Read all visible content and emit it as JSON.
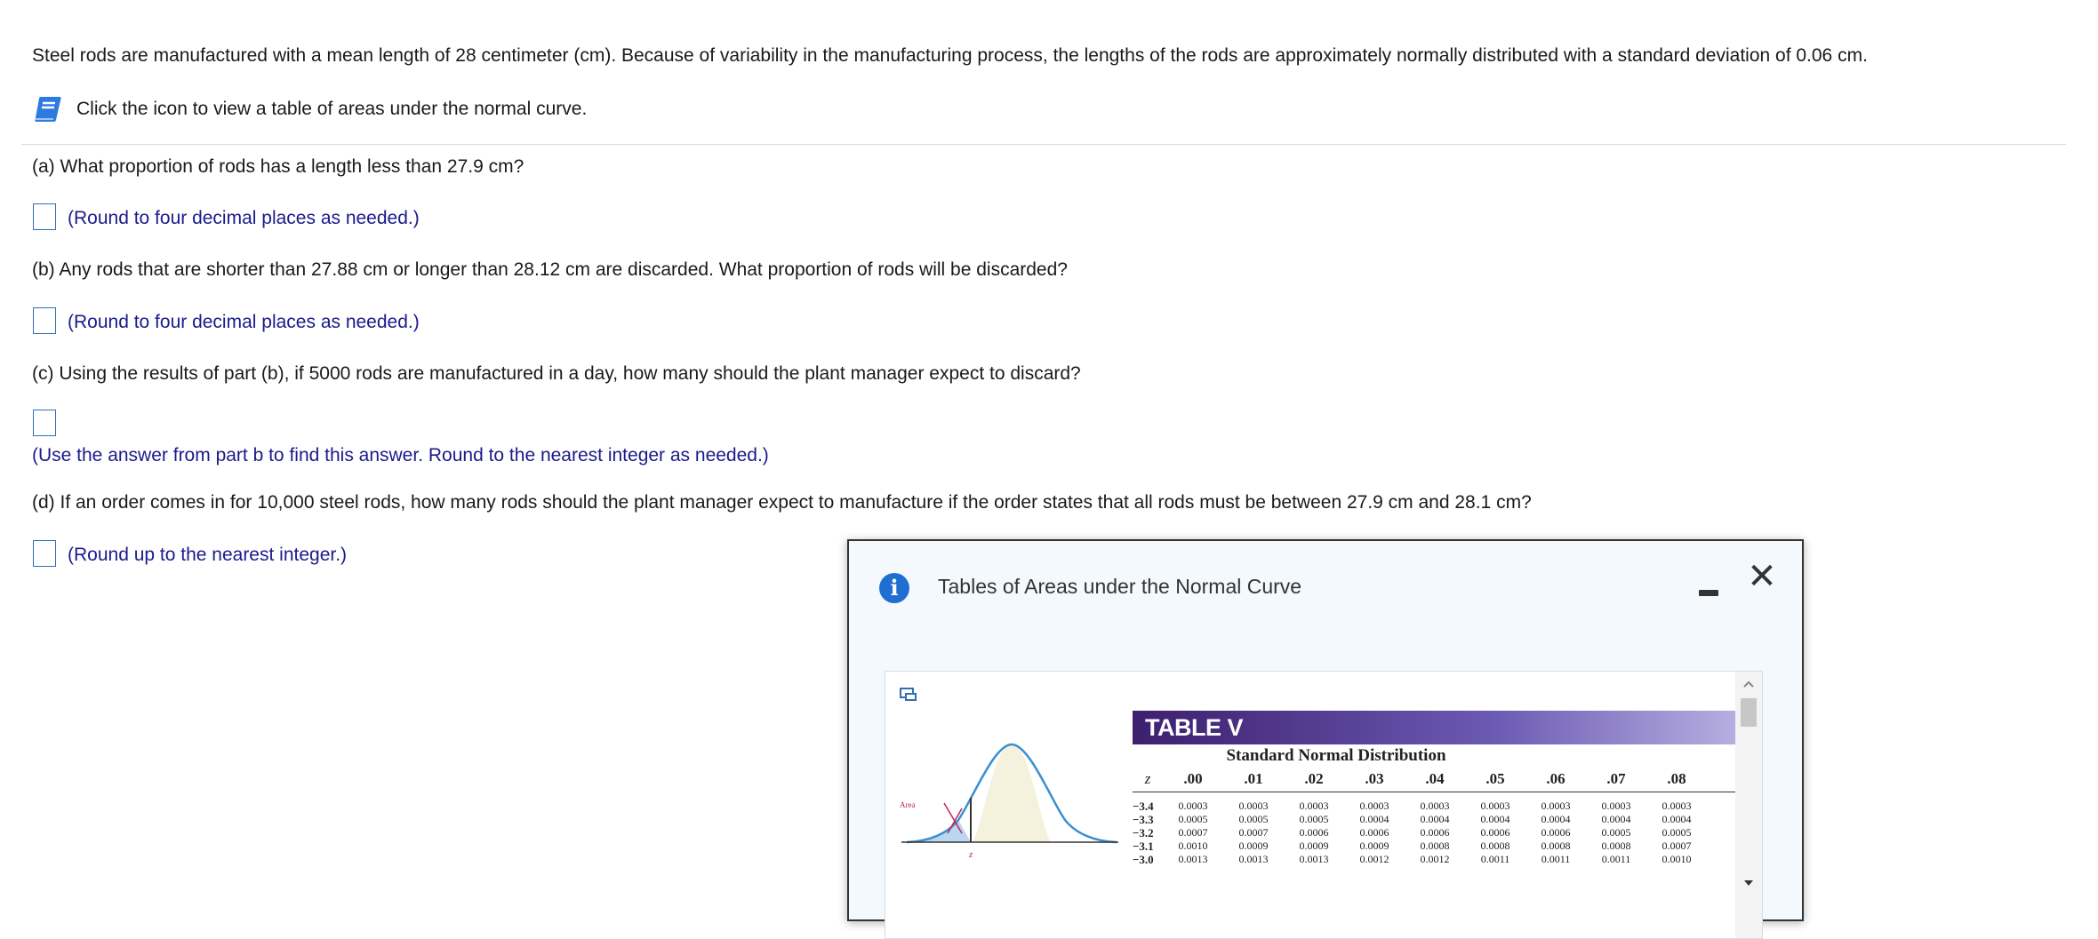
{
  "problem": {
    "intro": "Steel rods are manufactured with a mean length of 28 centimeter (cm). Because of variability in the manufacturing process, the lengths of the rods are approximately normally distributed with a standard deviation of 0.06 cm.",
    "table_link": "Click the icon to view a table of areas under the normal curve.",
    "q_a": "(a) What proportion of rods has a length less than 27.9 cm?",
    "hint_a": "(Round to four decimal places as needed.)",
    "q_b": "(b) Any rods that are shorter than 27.88 cm or longer than 28.12 cm are discarded. What proportion of rods will be discarded?",
    "hint_b": "(Round to four decimal places as needed.)",
    "q_c": "(c) Using the results of part (b), if 5000 rods are manufactured in a day, how many should the plant manager expect to discard?",
    "hint_c": "(Use the answer from part b to find this answer. Round to the nearest integer as needed.)",
    "q_d": "(d) If an order comes in for 10,000 steel rods, how many rods should the plant manager expect to manufacture if the order states that all rods must be between 27.9 cm and 28.1 cm?",
    "hint_d": "(Round up to the nearest integer.)"
  },
  "popup": {
    "title": "Tables of Areas under the Normal Curve",
    "figure_area_label": "Area",
    "figure_z_label": "z",
    "table_title": "TABLE V",
    "table_subtitle": "Standard Normal Distribution",
    "header_z": "z",
    "headers": [
      ".00",
      ".01",
      ".02",
      ".03",
      ".04",
      ".05",
      ".06",
      ".07",
      ".08"
    ],
    "rows": [
      {
        "z": "−3.4",
        "v": [
          "0.0003",
          "0.0003",
          "0.0003",
          "0.0003",
          "0.0003",
          "0.0003",
          "0.0003",
          "0.0003",
          "0.0003"
        ]
      },
      {
        "z": "−3.3",
        "v": [
          "0.0005",
          "0.0005",
          "0.0005",
          "0.0004",
          "0.0004",
          "0.0004",
          "0.0004",
          "0.0004",
          "0.0004"
        ]
      },
      {
        "z": "−3.2",
        "v": [
          "0.0007",
          "0.0007",
          "0.0006",
          "0.0006",
          "0.0006",
          "0.0006",
          "0.0006",
          "0.0005",
          "0.0005"
        ]
      },
      {
        "z": "−3.1",
        "v": [
          "0.0010",
          "0.0009",
          "0.0009",
          "0.0009",
          "0.0008",
          "0.0008",
          "0.0008",
          "0.0008",
          "0.0007"
        ]
      },
      {
        "z": "−3.0",
        "v": [
          "0.0013",
          "0.0013",
          "0.0013",
          "0.0012",
          "0.0012",
          "0.0011",
          "0.0011",
          "0.0011",
          "0.0010"
        ]
      }
    ]
  },
  "colors": {
    "hint_text": "#1b1a8c",
    "answer_box_border": "#2f6fb4",
    "info_icon": "#1f6fd3",
    "book_icon": "#2e7be0"
  }
}
